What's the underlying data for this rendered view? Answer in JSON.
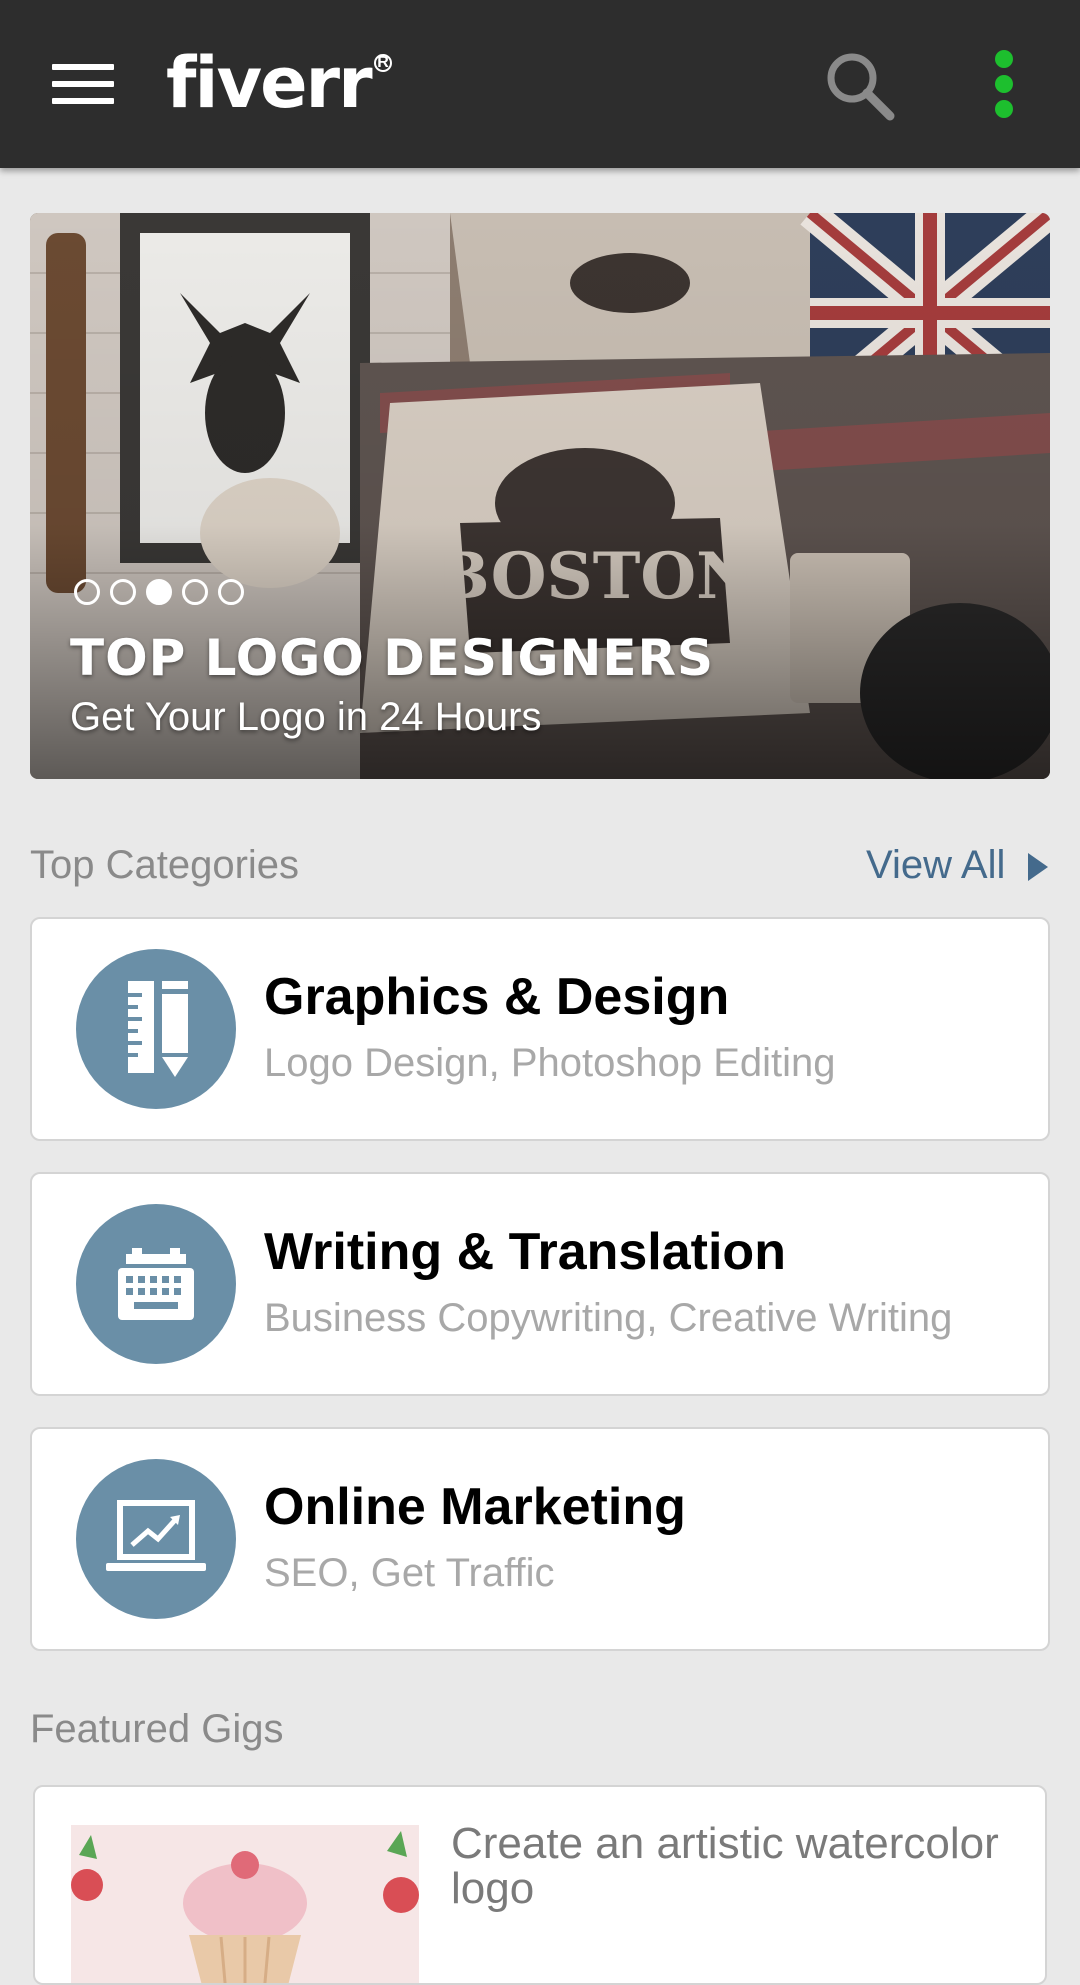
{
  "app": {
    "logo_text": "fiverr",
    "logo_mark": "R"
  },
  "header": {
    "icons": [
      "menu-icon",
      "search-icon",
      "more-vert-icon"
    ],
    "accent_color": "#1dbf2e"
  },
  "hero": {
    "title": "TOP LOGO DESIGNERS",
    "subtitle": "Get Your Logo in 24 Hours",
    "carousel_count": 5,
    "carousel_active_index": 2
  },
  "categories_section": {
    "label": "Top Categories",
    "view_all": "View All",
    "items": [
      {
        "title": "Graphics & Design",
        "subtitle": "Logo Design, Photoshop Editing",
        "icon": "ruler-pencil-icon"
      },
      {
        "title": "Writing & Translation",
        "subtitle": "Business Copywriting, Creative Writing",
        "icon": "typewriter-icon"
      },
      {
        "title": "Online Marketing",
        "subtitle": "SEO, Get Traffic",
        "icon": "laptop-chart-icon"
      }
    ],
    "icon_color": "#6a8fa7"
  },
  "featured_section": {
    "label": "Featured Gigs",
    "items": [
      {
        "title": "Create an artistic watercolor logo",
        "thumb": "cupcake-watercolor-image"
      }
    ]
  }
}
